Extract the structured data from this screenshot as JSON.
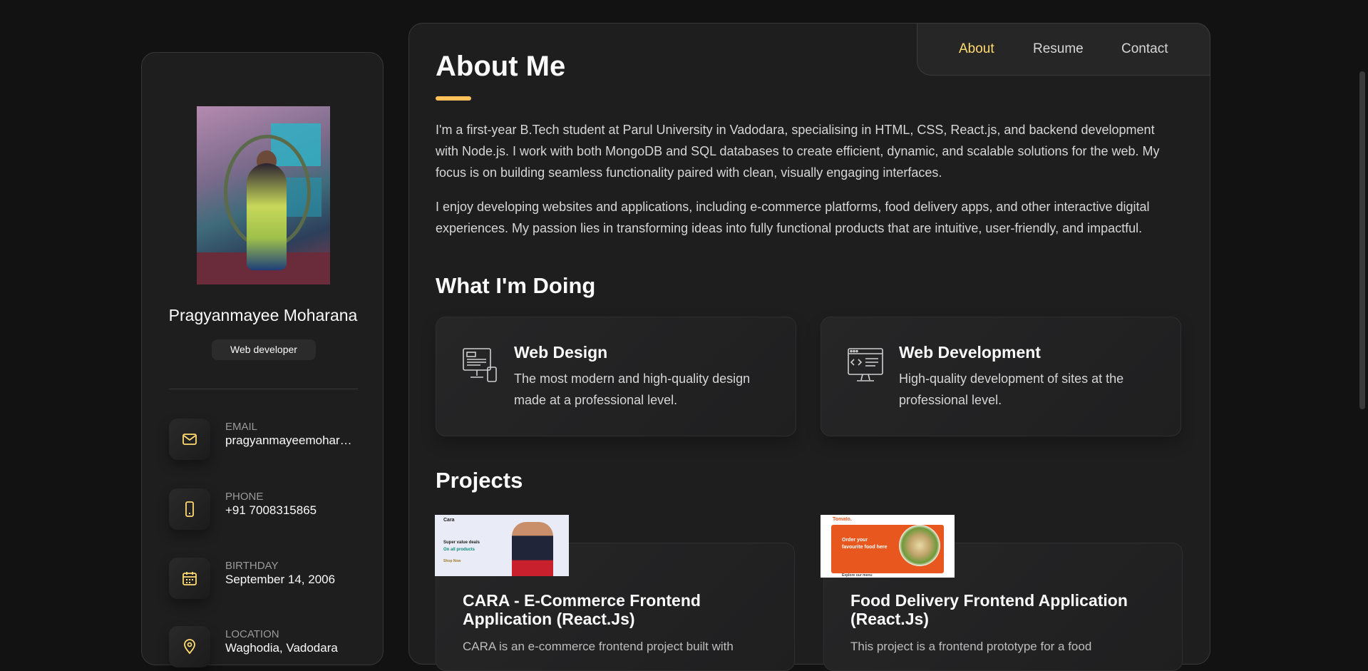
{
  "profile": {
    "name": "Pragyanmayee Moharana",
    "role": "Web developer",
    "contacts": [
      {
        "label": "EMAIL",
        "value": "pragyanmayeemohar…",
        "icon": "mail-icon"
      },
      {
        "label": "PHONE",
        "value": "+91 7008315865",
        "icon": "phone-icon"
      },
      {
        "label": "BIRTHDAY",
        "value": "September 14, 2006",
        "icon": "calendar-icon"
      },
      {
        "label": "LOCATION",
        "value": "Waghodia, Vadodara",
        "icon": "location-icon"
      }
    ]
  },
  "nav": {
    "items": [
      "About",
      "Resume",
      "Contact"
    ],
    "active": "About"
  },
  "about": {
    "title": "About Me",
    "paragraphs": [
      "I'm a first-year B.Tech student at Parul University in Vadodara, specialising in HTML, CSS, React.js, and backend development with Node.js. I work with both MongoDB and SQL databases to create efficient, dynamic, and scalable solutions for the web. My focus is on building seamless functionality paired with clean, visually engaging interfaces.",
      "I enjoy developing websites and applications, including e-commerce platforms, food delivery apps, and other interactive digital experiences. My passion lies in transforming ideas into fully functional products that are intuitive, user-friendly, and impactful."
    ]
  },
  "services": {
    "title": "What I'm Doing",
    "items": [
      {
        "title": "Web Design",
        "text": "The most modern and high-quality design made at a professional level.",
        "icon": "design-icon"
      },
      {
        "title": "Web Development",
        "text": "High-quality development of sites at the professional level.",
        "icon": "dev-icon"
      }
    ]
  },
  "projects": {
    "title": "Projects",
    "items": [
      {
        "title": "CARA - E-Commerce Frontend Application (React.Js)",
        "desc": "CARA is an e-commerce frontend project built with"
      },
      {
        "title": "Food Delivery Frontend Application (React.Js)",
        "desc": "This project is a frontend prototype for a food"
      }
    ]
  },
  "thumbs": {
    "cara": {
      "logo": "Cara",
      "line1": "Super value deals",
      "line2": "On all products",
      "button": "Shop Now"
    },
    "food": {
      "logo": "Tomato.",
      "line1": "Order your",
      "line2": "favourite food here",
      "footer": "Explore our menu"
    }
  },
  "colors": {
    "accent": "#ffdb70",
    "background": "#121212",
    "card": "#1e1e1f"
  }
}
